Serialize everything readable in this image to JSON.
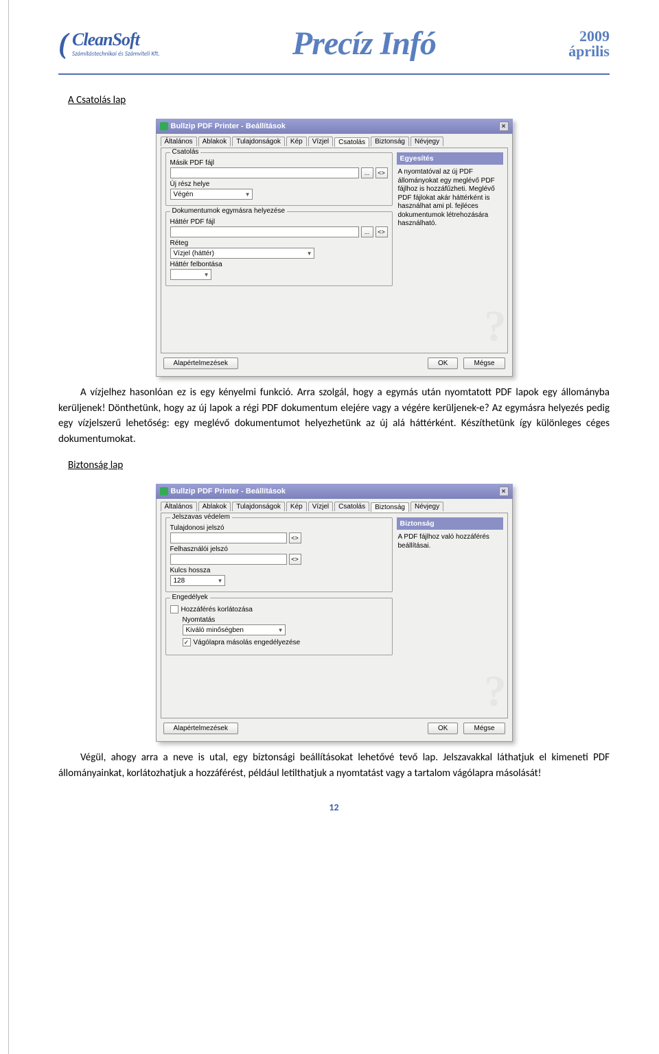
{
  "header": {
    "logo_big": "CleanSoft",
    "logo_small": "Számítástechnikai és Számviteli Kft.",
    "center_title": "Precíz Infó",
    "year": "2009",
    "month": "április"
  },
  "section1_heading": "A Csatolás lap",
  "section2_heading": "Biztonság lap",
  "para1": "A vízjelhez hasonlóan ez is egy kényelmi funkció. Arra szolgál, hogy a egymás után nyomtatott PDF lapok egy állományba kerüljenek! Dönthetünk, hogy az új lapok a régi PDF dokumentum elejére vagy a végére kerüljenek-e? Az egymásra helyezés pedig egy vízjelszerű lehetőség: egy meglévő dokumentumot helyezhetünk az új alá háttérként. Készíthetünk így különleges céges dokumentumokat.",
  "para2": "Végül, ahogy arra a neve is utal, egy biztonsági beállításokat lehetővé tevő lap. Jelszavakkal láthatjuk el kimeneti PDF állományainkat, korlátozhatjuk a hozzáférést, például letilthatjuk a nyomtatást vagy a tartalom vágólapra másolását!",
  "page_number": "12",
  "dlg": {
    "title": "Bullzip PDF Printer - Beállítások",
    "tabs": [
      "Általános",
      "Ablakok",
      "Tulajdonságok",
      "Kép",
      "Vízjel",
      "Csatolás",
      "Biztonság",
      "Névjegy"
    ],
    "btn_defaults": "Alapértelmezések",
    "btn_ok": "OK",
    "btn_cancel": "Mégse",
    "browse": "...",
    "macro": "<>"
  },
  "csat": {
    "active_tab": "Csatolás",
    "group1": "Csatolás",
    "lbl_masik": "Másik PDF fájl",
    "lbl_ujresz": "Új rész helye",
    "dd_ujresz": "Végén",
    "group2": "Dokumentumok egymásra helyezése",
    "lbl_hatterfajl": "Háttér PDF fájl",
    "lbl_reteg": "Réteg",
    "dd_reteg": "Vízjel (háttér)",
    "lbl_hatterfelb": "Háttér felbontása",
    "side_head": "Egyesítés",
    "side_text": "A nyomtatóval az új PDF állományokat egy meglévő PDF fájlhoz is hozzáfűzheti. Meglévő PDF fájlokat akár háttérként is használhat ami pl. fejléces dokumentumok létrehozására használható."
  },
  "biz": {
    "active_tab": "Biztonság",
    "group1": "Jelszavas védelem",
    "lbl_tulaj": "Tulajdonosi jelszó",
    "lbl_felh": "Felhasználói jelszó",
    "lbl_kulcs": "Kulcs hossza",
    "dd_kulcs": "128",
    "group2": "Engedélyek",
    "chk_hozzaferes": "Hozzáférés korlátozása",
    "lbl_nyomtatas": "Nyomtatás",
    "dd_nyomtatas": "Kiváló minőségben",
    "chk_vagolap": "Vágólapra másolás engedélyezése",
    "side_head": "Biztonság",
    "side_text": "A PDF fájlhoz való hozzáférés beállításai."
  }
}
